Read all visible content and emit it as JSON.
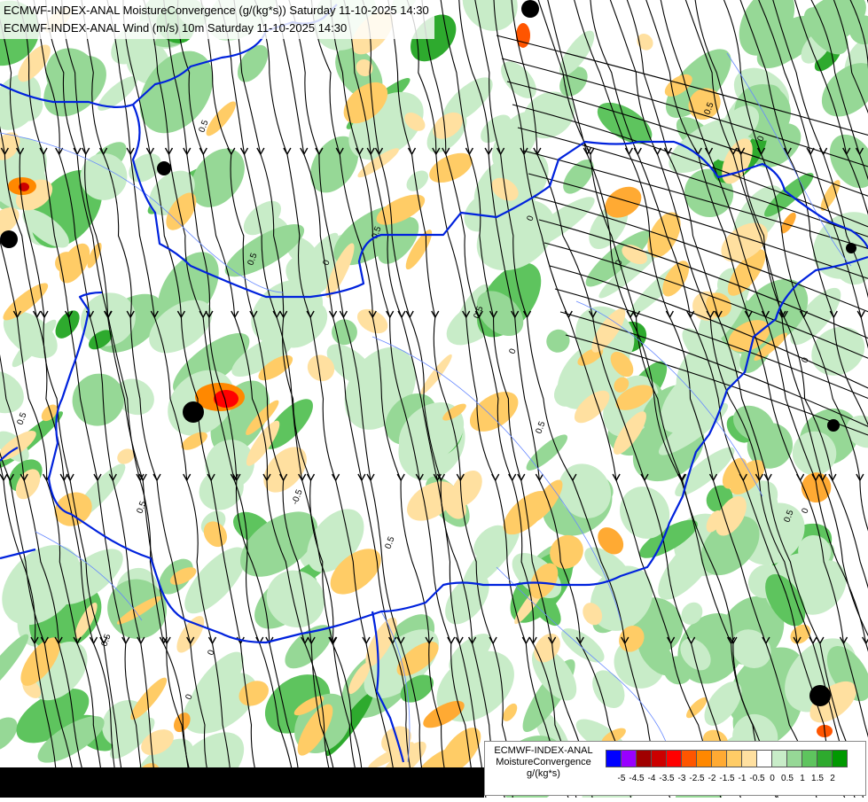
{
  "titles": {
    "line1": "ECMWF-INDEX-ANAL MoistureConvergence (g/(kg*s)) Saturday 11-10-2025 14:30",
    "line2": "ECMWF-INDEX-ANAL Wind (m/s) 10m Saturday 11-10-2025 14:30"
  },
  "legend": {
    "name_line1": "ECMWF-INDEX-ANAL",
    "name_line2": "MoistureConvergence",
    "unit": "g/(kg*s)",
    "colors": [
      "#0000ff",
      "#9900ff",
      "#a00000",
      "#cc0000",
      "#ff0000",
      "#ff5500",
      "#ff8800",
      "#ffaa33",
      "#ffcc66",
      "#ffe0a0",
      "#ffffff",
      "#c8ecc8",
      "#96d896",
      "#5ec45e",
      "#2eaa2e",
      "#009900"
    ],
    "ticks": [
      "-5",
      "-4.5",
      "-4",
      "-3.5",
      "-3",
      "-2.5",
      "-2",
      "-1.5",
      "-1",
      "-0.5",
      "0",
      "0.5",
      "1",
      "1.5",
      "2"
    ]
  },
  "contour_labels": [
    "0.5",
    "0",
    "0.5",
    "-0.5",
    "0.5",
    "0",
    "0.5",
    "0",
    "0.5",
    "0",
    "0.5",
    "0",
    "0.5",
    "0",
    "0.5",
    "0",
    "0",
    "0.5",
    "0",
    "0.5",
    "0.5"
  ],
  "map_colors": {
    "border": "#0022dd",
    "rivers": "#6688ff",
    "streamline": "#000000"
  }
}
